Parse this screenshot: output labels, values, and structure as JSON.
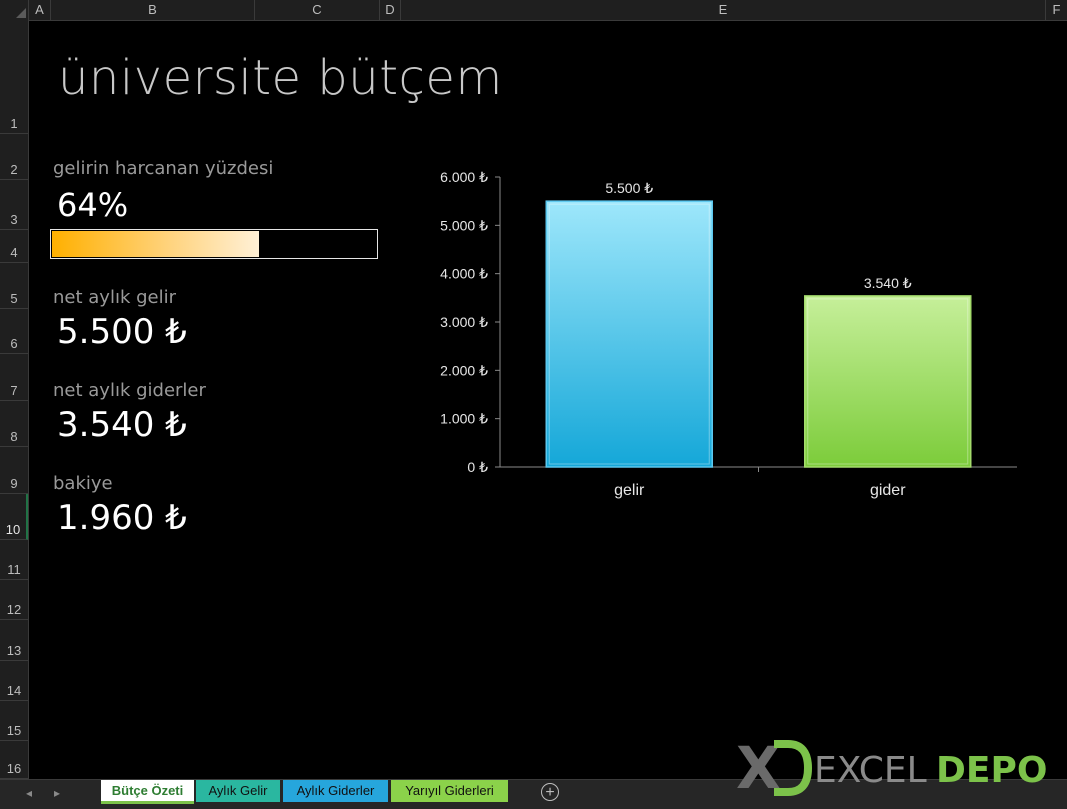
{
  "columns": [
    "A",
    "B",
    "C",
    "D",
    "E",
    "F"
  ],
  "rows": [
    "1",
    "2",
    "3",
    "4",
    "5",
    "6",
    "7",
    "8",
    "9",
    "10",
    "11",
    "12",
    "13",
    "14",
    "15",
    "16"
  ],
  "active_row": "10",
  "title": "üniversite bütçem",
  "metrics": {
    "spent_label": "gelirin harcanan yüzdesi",
    "spent_value": "64%",
    "spent_fraction": 0.64,
    "income_label": "net aylık gelir",
    "income_value": "5.500 ₺",
    "expenses_label": "net aylık giderler",
    "expenses_value": "3.540 ₺",
    "balance_label": "bakiye",
    "balance_value": "1.960 ₺"
  },
  "chart_data": {
    "type": "bar",
    "categories": [
      "gelir",
      "gider"
    ],
    "values": [
      5500,
      3540
    ],
    "data_labels": [
      "5.500 ₺",
      "3.540 ₺"
    ],
    "yticks": [
      "0 ₺",
      "1.000 ₺",
      "2.000 ₺",
      "3.000 ₺",
      "4.000 ₺",
      "5.000 ₺",
      "6.000 ₺"
    ],
    "ylim": [
      0,
      6000
    ],
    "title": "",
    "xlabel": "",
    "ylabel": "",
    "grid": false,
    "legend": "none",
    "colors": [
      "#3fbfe6",
      "#8fd24e"
    ]
  },
  "tabs": [
    {
      "label": "Bütçe Özeti",
      "color": "#ffffff",
      "active": true
    },
    {
      "label": "Aylık Gelir",
      "color": "#2ab7a0",
      "active": false
    },
    {
      "label": "Aylık Giderler",
      "color": "#26a6dc",
      "active": false
    },
    {
      "label": "Yarıyıl Giderleri",
      "color": "#8bd24a",
      "active": false
    }
  ],
  "logo": {
    "mark": "X",
    "text_left": "EXCEL",
    "text_right": "DEPO"
  }
}
